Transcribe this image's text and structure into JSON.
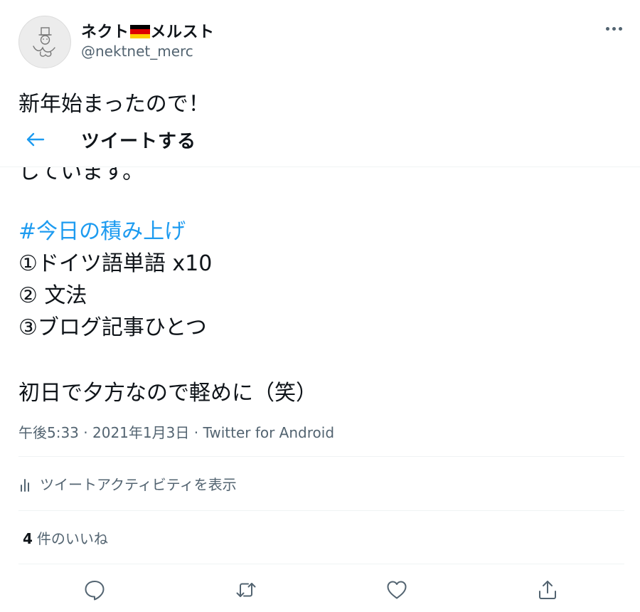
{
  "author": {
    "name_part1": "ネクト",
    "name_part2": "メルスト",
    "handle": "@nektnet_merc",
    "flag_colors": [
      "#000000",
      "#dd0000",
      "#ffce00"
    ]
  },
  "header": {
    "more_icon": "more-horizontal-icon"
  },
  "sticky_bar": {
    "back_icon": "arrow-left-icon",
    "title": "ツイートする"
  },
  "tweet": {
    "line1": "新年始まったので！",
    "partial_line": "しています。",
    "hashtag": "#今日の積み上げ",
    "items": [
      "①ドイツ語単語 x10",
      "② 文法",
      "③ブログ記事ひとつ"
    ],
    "closing": "初日で夕方なので軽めに（笑）"
  },
  "meta": {
    "time": "午後5:33",
    "separator": "·",
    "date": "2021年1月3日",
    "source": "Twitter for Android"
  },
  "activity": {
    "label": "ツイートアクティビティを表示",
    "icon": "analytics-bars-icon"
  },
  "likes": {
    "count": "4",
    "label": "件のいいね"
  },
  "actions": [
    {
      "name": "reply",
      "icon": "reply-bubble-icon"
    },
    {
      "name": "retweet",
      "icon": "retweet-icon"
    },
    {
      "name": "like",
      "icon": "heart-icon"
    },
    {
      "name": "share",
      "icon": "share-icon"
    }
  ],
  "colors": {
    "accent": "#1d9bf0",
    "text": "#0f1419",
    "secondary": "#536471",
    "divider": "#eff3f4"
  }
}
